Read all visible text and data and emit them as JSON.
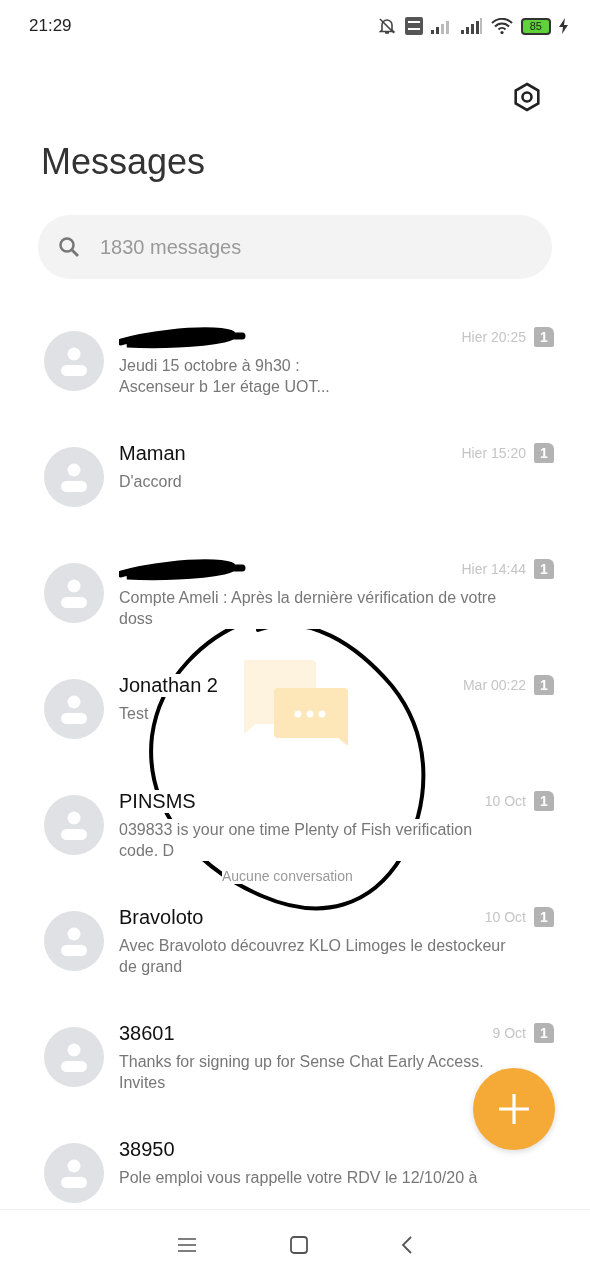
{
  "status_bar": {
    "time": "21:29",
    "battery": "85"
  },
  "title": "Messages",
  "search": {
    "placeholder": "1830 messages"
  },
  "conversations": [
    {
      "redacted": true,
      "time": "Hier 20:25",
      "sim": "1",
      "preview": "Jeudi 15 octobre à 9h30 :\nAscenseur b 1er étage UOT..."
    },
    {
      "name": "Maman",
      "redacted": false,
      "time": "Hier 15:20",
      "sim": "1",
      "preview": "D'accord"
    },
    {
      "redacted": true,
      "time": "Hier 14:44",
      "sim": "1",
      "preview": "Compte Ameli : Après la dernière vérification de votre doss"
    },
    {
      "name": "Jonathan 2",
      "redacted": false,
      "time": "Mar 00:22",
      "sim": "1",
      "preview": "Test"
    },
    {
      "name": "PINSMS",
      "redacted": false,
      "time": "10 Oct",
      "sim": "1",
      "preview": "039833 is your one time Plenty of Fish verification code. D"
    },
    {
      "name": "Bravoloto",
      "redacted": false,
      "time": "10 Oct",
      "sim": "1",
      "preview": "Avec Bravoloto découvrez KLO Limoges le destockeur de grand"
    },
    {
      "name": "38601",
      "redacted": false,
      "time": "9 Oct",
      "sim": "1",
      "preview": "Thanks for signing up for Sense Chat Early Access. Invites"
    },
    {
      "name": "38950",
      "redacted": false,
      "preview": "Pole emploi vous rappelle votre RDV le 12/10/20 à"
    }
  ],
  "empty_state": {
    "text": "Aucune conversation"
  }
}
